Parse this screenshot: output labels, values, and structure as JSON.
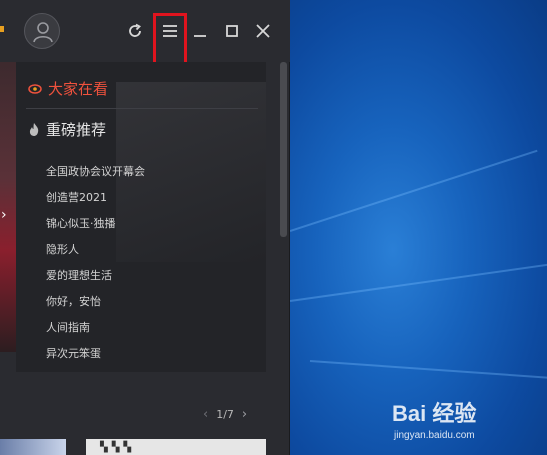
{
  "app": {
    "menu_highlight_color": "#e0141e",
    "icons": {
      "avatar": "user-avatar-icon",
      "refresh": "refresh-icon",
      "menu": "hamburger-menu-icon",
      "minimize": "minimize-icon",
      "maximize": "maximize-icon",
      "close": "close-icon"
    }
  },
  "menu": {
    "hot_label": "大家在看",
    "hot_color": "#f0523d",
    "recommend_label": "重磅推荐",
    "items": [
      "全国政协会议开幕会",
      "创造营2021",
      "锦心似玉·独播",
      "隐形人",
      "爱的理想生活",
      "你好，安怡",
      "人间指南",
      "异次元笨蛋"
    ]
  },
  "pager": {
    "text": "1/7"
  },
  "watermark": {
    "brand": "Bai 经验",
    "url": "jingyan.baidu.com"
  }
}
